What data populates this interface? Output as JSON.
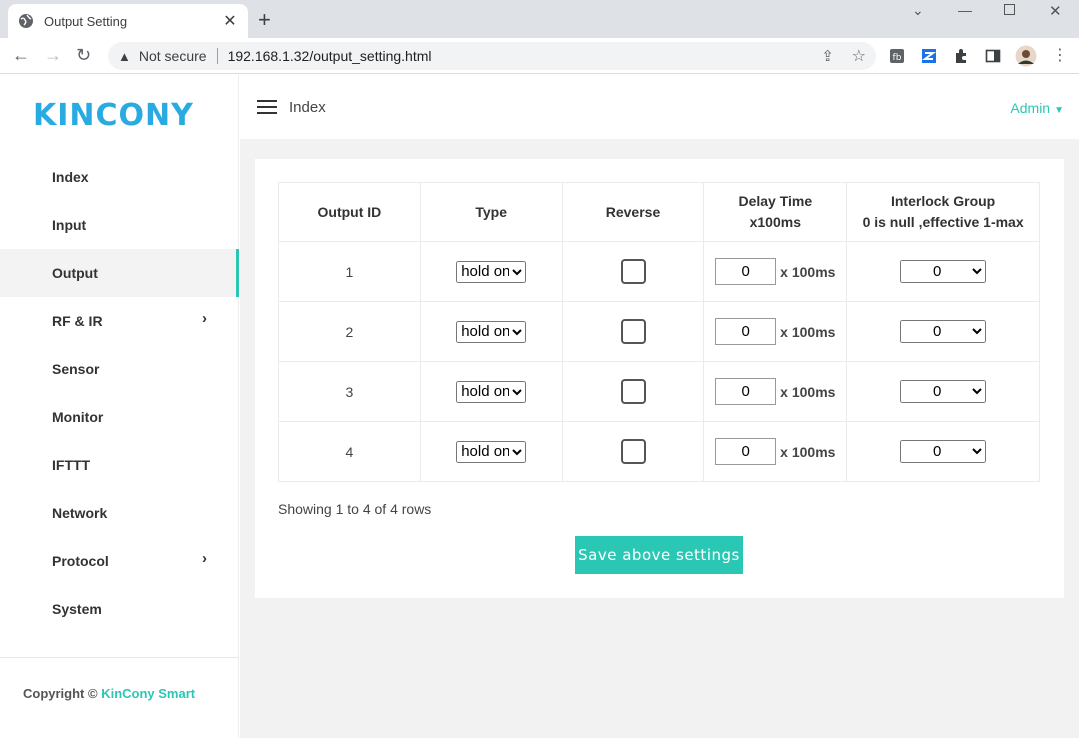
{
  "browser": {
    "tab_title": "Output Setting",
    "not_secure": "Not secure",
    "url": "192.168.1.32/output_setting.html"
  },
  "sidebar": {
    "logo": "KINCONY",
    "items": [
      {
        "label": "Index"
      },
      {
        "label": "Input"
      },
      {
        "label": "Output",
        "active": true
      },
      {
        "label": "RF & IR",
        "has_submenu": true
      },
      {
        "label": "Sensor"
      },
      {
        "label": "Monitor"
      },
      {
        "label": "IFTTT"
      },
      {
        "label": "Network"
      },
      {
        "label": "Protocol",
        "has_submenu": true
      },
      {
        "label": "System"
      }
    ],
    "footer_prefix": "Copyright ©",
    "footer_brand": "KinCony Smart"
  },
  "header": {
    "breadcrumb": "Index",
    "user": "Admin"
  },
  "table": {
    "headers": {
      "id": "Output ID",
      "type": "Type",
      "reverse": "Reverse",
      "delay_line1": "Delay Time",
      "delay_line2": "x100ms",
      "interlock_line1": "Interlock Group",
      "interlock_line2": "0 is null ,effective 1-max"
    },
    "delay_unit": "x 100ms",
    "rows": [
      {
        "id": "1",
        "type": "hold on",
        "reverse": false,
        "delay": "0",
        "group": "0"
      },
      {
        "id": "2",
        "type": "hold on",
        "reverse": false,
        "delay": "0",
        "group": "0"
      },
      {
        "id": "3",
        "type": "hold on",
        "reverse": false,
        "delay": "0",
        "group": "0"
      },
      {
        "id": "4",
        "type": "hold on",
        "reverse": false,
        "delay": "0",
        "group": "0"
      }
    ]
  },
  "footer_text": "Showing 1 to 4 of 4 rows",
  "save_label": "Save above settings",
  "colors": {
    "accent": "#2ac7b4",
    "logo": "#29abe2"
  }
}
